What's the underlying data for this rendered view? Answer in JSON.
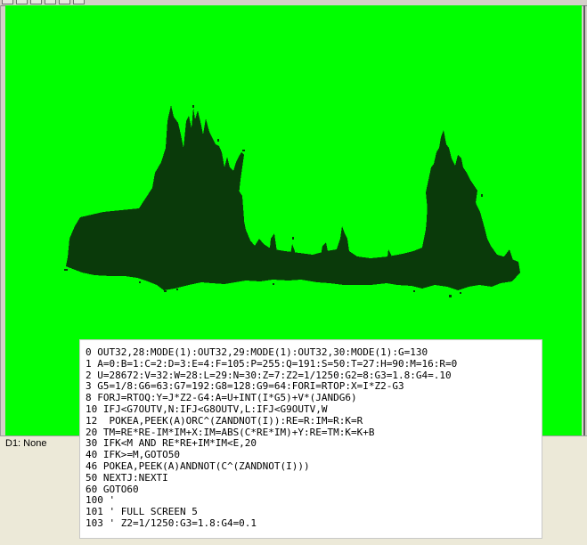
{
  "window": {
    "toolbar_buttons": [
      "toolbar-button-1",
      "toolbar-button-2",
      "toolbar-button-3",
      "toolbar-button-4",
      "toolbar-button-5",
      "toolbar-button-6"
    ]
  },
  "screen": {
    "background_color": "#00ff00",
    "fractal_color": "#0a3a0a"
  },
  "status_bar": {
    "disk_label": "D1: None"
  },
  "listing": {
    "lines": [
      "0 OUT32,28:MODE(1):OUT32,29:MODE(1):OUT32,30:MODE(1):G=130",
      "1 A=0:B=1:C=2:D=3:E=4:F=105:P=255:Q=191:S=50:T=27:H=90:M=16:R=0",
      "2 U=28672:V=32:W=28:L=29:N=30:Z=7:Z2=1/1250:G2=8:G3=1.8:G4=.10",
      "3 G5=1/8:G6=63:G7=192:G8=128:G9=64:FORI=RTOP:X=I*Z2-G3",
      "8 FORJ=RTOQ:Y=J*Z2-G4:A=U+INT(I*G5)+V*(JANDG6)",
      "10 IFJ<G7OUTV,N:IFJ<G8OUTV,L:IFJ<G9OUTV,W",
      "12  POKEA,PEEK(A)ORC^(ZANDNOT(I)):RE=R:IM=R:K=R",
      "20 TM=RE*RE-IM*IM+X:IM=ABS(C*RE*IM)+Y:RE=TM:K=K+B",
      "30 IFK<M AND RE*RE+IM*IM<E,20",
      "40 IFK>=M,GOTO50",
      "46 POKEA,PEEK(A)ANDNOT(C^(ZANDNOT(I)))",
      "50 NEXTJ:NEXTI",
      "60 GOTO60",
      "100 '",
      "101 ' FULL SCREEN 5",
      "103 ' Z2=1/1250:G3=1.8:G4=0.1"
    ]
  }
}
